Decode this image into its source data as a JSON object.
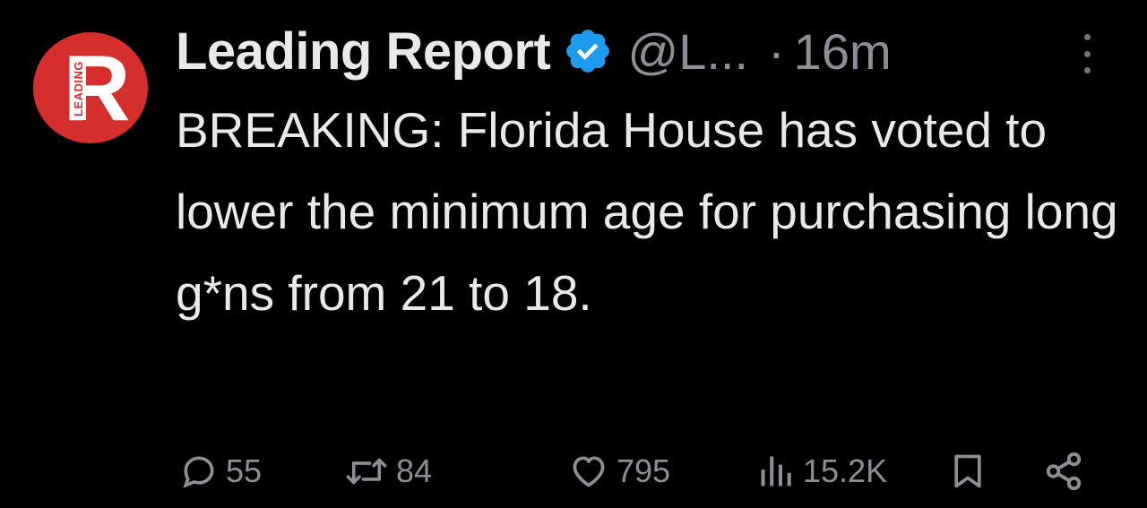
{
  "post": {
    "author": {
      "display_name": "Leading Report",
      "handle": "@L...",
      "verified": true,
      "avatar_letter": "R",
      "avatar_side_text": "LEADING"
    },
    "separator": "·",
    "time": "16m",
    "text": "BREAKING: Florida House has voted to lower the minimum age for purchasing long g*ns from 21 to 18.",
    "actions": {
      "replies": "55",
      "reposts": "84",
      "likes": "795",
      "views": "15.2K"
    }
  },
  "colors": {
    "background": "#000000",
    "text": "#e7e9ea",
    "muted": "#8b9096",
    "avatar_red": "#d62d2d",
    "verified_blue": "#1d9bf0"
  },
  "icons": [
    "more-icon",
    "verified-badge-icon",
    "reply-icon",
    "repost-icon",
    "like-icon",
    "views-icon",
    "bookmark-icon",
    "share-icon"
  ]
}
